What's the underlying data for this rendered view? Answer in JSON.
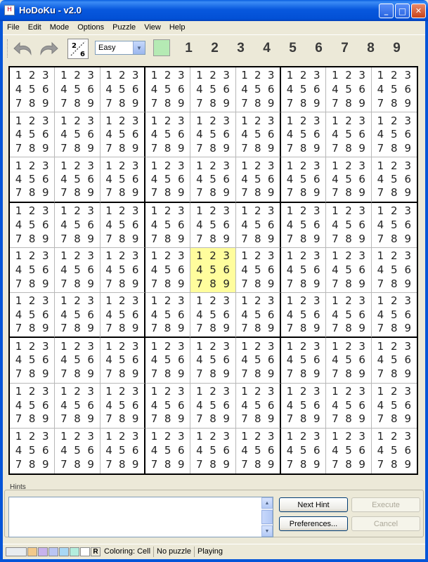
{
  "window": {
    "title": "HoDoKu - v2.0",
    "minimize_label": "_",
    "maximize_label": "□",
    "close_label": "✕"
  },
  "menu": [
    "File",
    "Edit",
    "Mode",
    "Options",
    "Puzzle",
    "View",
    "Help"
  ],
  "toolbar": {
    "undo_icon": "undo-arrow-icon",
    "redo_icon": "redo-arrow-icon",
    "level_icon_digits": [
      "2",
      "6"
    ],
    "level_value": "Easy",
    "color_swatch": "#b5eab4",
    "filter_digits": [
      "1",
      "2",
      "3",
      "4",
      "5",
      "6",
      "7",
      "8",
      "9"
    ]
  },
  "board": {
    "candidates": [
      "1",
      "2",
      "3",
      "4",
      "5",
      "6",
      "7",
      "8",
      "9"
    ],
    "selected_cell": {
      "row": 5,
      "col": 5
    },
    "selected_color": "#fffd9d"
  },
  "hints": {
    "label": "Hints",
    "text": "",
    "next_hint": "Next Hint",
    "execute": "Execute",
    "preferences": "Preferences...",
    "cancel": "Cancel"
  },
  "status": {
    "swatches": [
      "#e8ecf0",
      "#f3c98a",
      "#c7b2ec",
      "#b9c5f3",
      "#a9d7f5",
      "#b3eddd",
      "#ffffff"
    ],
    "r_label": "R",
    "coloring": "Coloring: Cell",
    "puzzle": "No puzzle",
    "state": "Playing"
  }
}
